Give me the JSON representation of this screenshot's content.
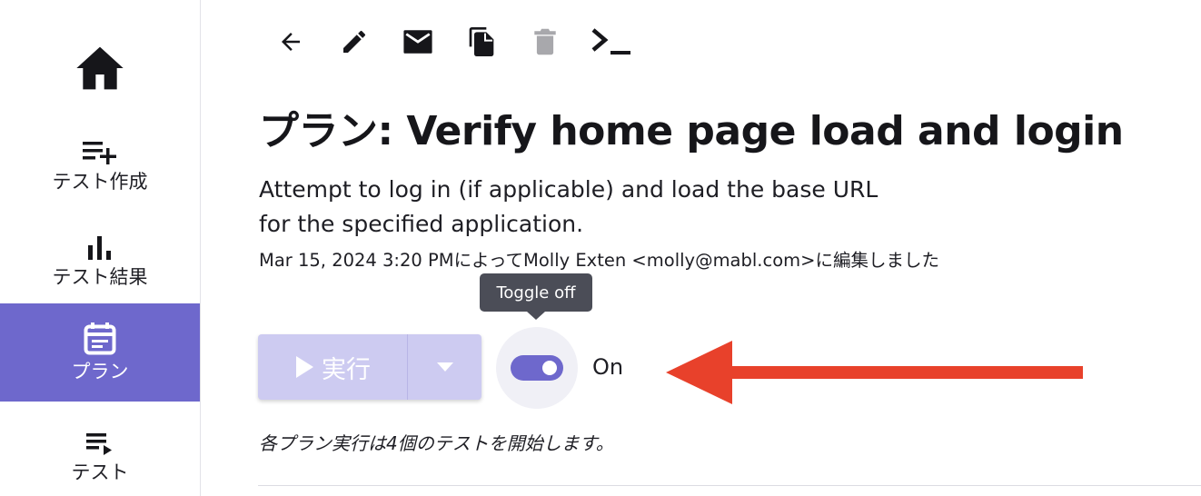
{
  "sidebar": {
    "items": [
      {
        "label": "",
        "icon": "home-icon"
      },
      {
        "label": "テスト作成",
        "icon": "playlist-add-icon"
      },
      {
        "label": "テスト結果",
        "icon": "bar-chart-icon"
      },
      {
        "label": "プラン",
        "icon": "calendar-icon",
        "active": true
      },
      {
        "label": "テスト",
        "icon": "playlist-play-icon"
      }
    ],
    "active_color": "#6e68cc"
  },
  "toolbar": {
    "icons": [
      "back-arrow-icon",
      "edit-pencil-icon",
      "mail-icon",
      "copy-icon",
      "trash-icon",
      "terminal-icon"
    ]
  },
  "plan": {
    "title": "プラン: Verify home page load and login",
    "description_line1": "Attempt to log in (if applicable) and load the base URL",
    "description_line2": "for the specified application.",
    "edited_by": "Mar 15, 2024 3:20 PMによってMolly Exten <molly@mabl.com>に編集しました"
  },
  "run_button": {
    "label": "実行",
    "icon": "play-icon",
    "dropdown_icon": "caret-down-icon",
    "color": "#cdcbf1"
  },
  "toggle": {
    "tooltip": "Toggle off",
    "state_label": "On",
    "on": true,
    "color": "#6e68cc"
  },
  "footer_note": "各プラン実行は4個のテストを開始します。",
  "annotation": {
    "color": "#e8412b"
  }
}
